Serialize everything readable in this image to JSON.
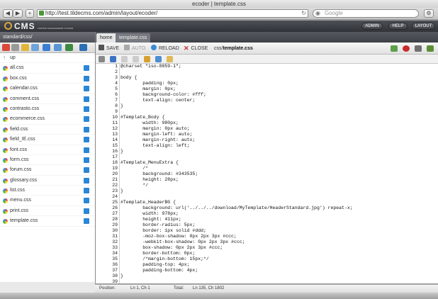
{
  "window": {
    "title": "ecoder | template.css"
  },
  "browser": {
    "url": "http://test.tildecms.com/admin/layout/ecoder/",
    "search_placeholder": "Google",
    "back": "◀",
    "forward": "▶",
    "add_tab": "+",
    "reload": "↻",
    "settings": "⚙"
  },
  "cms": {
    "logo": "CMS",
    "logo_sub": "CONTENT MANAGEMENT SYSTEM",
    "nav": [
      "ADMIN",
      "HELP",
      "LAYOUT"
    ]
  },
  "sidebar": {
    "path": "standard/css/",
    "up_label": "up",
    "files": [
      "all.css",
      "box.css",
      "calendar.css",
      "comment.css",
      "contrasto.css",
      "ecommerce.css",
      "field.css",
      "field_IE.css",
      "font.css",
      "form.css",
      "forum.css",
      "glossary.css",
      "list.css",
      "menu.css",
      "print.css",
      "template.css"
    ]
  },
  "tabs": [
    "home",
    "template.css"
  ],
  "toolbar": {
    "save": "SAVE",
    "auto": "AUTO",
    "reload": "RELOAD",
    "close": "CLOSE",
    "path_prefix": "css/",
    "file": "template.css"
  },
  "editor": {
    "lines": [
      "@charset \"iso-8859-1\";",
      "",
      "body {",
      "        padding: 0px;",
      "        margin: 0px;",
      "        background-color: #fff;",
      "        text-align: center;",
      "}",
      "",
      "#Template_Body {",
      "        width: 980px;",
      "        margin: 0px auto;",
      "        margin-left: auto;",
      "        margin-right: auto;",
      "        text-align: left;",
      "}",
      "",
      "#Template_MenuExtra {",
      "        /*",
      "        background: #343535;",
      "        height: 28px;",
      "        */",
      "}",
      "",
      "#Template_HeaderBG {",
      "        background: url('../../../download/MyTemplate/HeaderStandard.jpg') repeat-x;",
      "        width: 978px;",
      "        height: 411px;",
      "        border-radius: 5px;",
      "        border: 1px solid #ddd;",
      "        -moz-box-shadow: 0px 2px 3px #ccc;",
      "        -webkit-box-shadow: 0px 2px 3px #ccc;",
      "        box-shadow: 0px 2px 3px #ccc;",
      "        border-bottom: 0px;",
      "        /*margin-bottom: 15px;*/",
      "        padding-top: 4px;",
      "        padding-bottom: 4px;",
      "}",
      ""
    ]
  },
  "status": {
    "position_label": "Position:",
    "position_value": "Ln 1, Ch 1",
    "total_label": "Total:",
    "total_value": "Ln 135, Ch 1802"
  }
}
